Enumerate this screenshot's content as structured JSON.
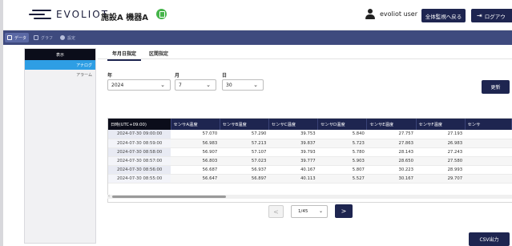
{
  "header": {
    "logo_text": "EVOLIOT",
    "facility_label": "施設A 機器A",
    "username": "evoliot user",
    "all_monitor_button": "全体監視へ戻る",
    "logout_button": "ログアウ"
  },
  "tabbar": {
    "tabs": [
      {
        "label": "データ",
        "icon": "table-icon"
      },
      {
        "label": "グラフ",
        "icon": "chart-icon"
      },
      {
        "label": "設定",
        "icon": "gear-icon"
      }
    ]
  },
  "sidebar": {
    "heading": "表示",
    "items": [
      {
        "label": "アナログ",
        "active": true
      },
      {
        "label": "アラーム",
        "active": false
      }
    ]
  },
  "main": {
    "subtabs": [
      {
        "label": "年月日指定",
        "active": true
      },
      {
        "label": "区間指定",
        "active": false
      }
    ],
    "filters": {
      "year_label": "年",
      "year_value": "2024",
      "month_label": "月",
      "month_value": "7",
      "day_label": "日",
      "day_value": "30"
    },
    "refresh_button": "更新",
    "table": {
      "columns": [
        "日時(UTC+09:00)",
        "センサA温度",
        "センサB温度",
        "センサC温度",
        "センサD温度",
        "センサE温度",
        "センサF温度",
        "センサ"
      ],
      "rows": [
        [
          "2024-07-30 09:00:00",
          "57.070",
          "57.290",
          "39.753",
          "5.840",
          "27.757",
          "27.193"
        ],
        [
          "2024-07-30 08:59:00",
          "56.983",
          "57.213",
          "39.837",
          "5.723",
          "27.863",
          "26.983"
        ],
        [
          "2024-07-30 08:58:00",
          "56.907",
          "57.107",
          "39.793",
          "5.780",
          "28.143",
          "27.243"
        ],
        [
          "2024-07-30 08:57:00",
          "56.803",
          "57.023",
          "39.777",
          "5.903",
          "28.650",
          "27.580"
        ],
        [
          "2024-07-30 08:56:00",
          "56.687",
          "56.937",
          "40.167",
          "5.807",
          "30.223",
          "28.993"
        ],
        [
          "2024-07-30 08:55:00",
          "56.647",
          "56.897",
          "40.113",
          "5.527",
          "30.167",
          "29.707"
        ]
      ]
    },
    "pager": {
      "prev": "<",
      "current": "1/45",
      "next": ">"
    },
    "csv_button": "CSV出力"
  },
  "colors": {
    "navy": "#1e2550",
    "tabbar": "#3e4a7e",
    "accent_blue": "#2e9ee4",
    "status_green": "#45b449"
  }
}
